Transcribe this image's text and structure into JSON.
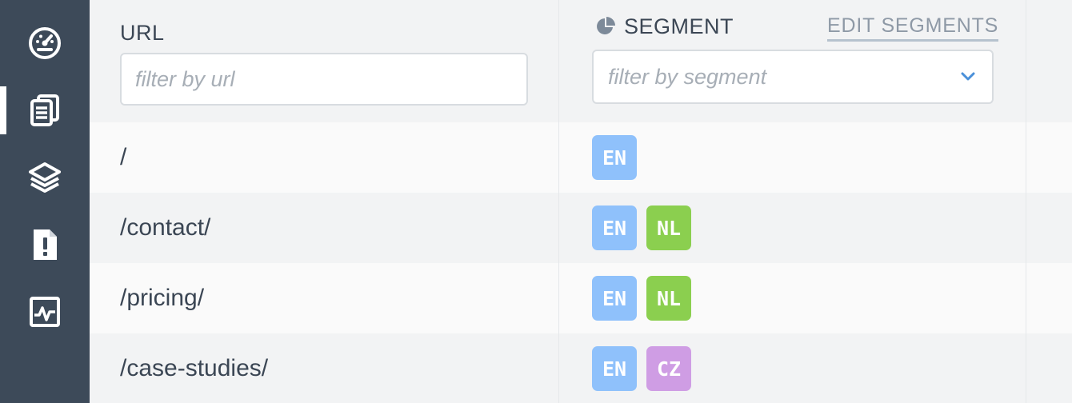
{
  "sidebar": {
    "items": [
      {
        "icon": "dashboard-icon",
        "active": false
      },
      {
        "icon": "pages-icon",
        "active": true
      },
      {
        "icon": "layers-icon",
        "active": false
      },
      {
        "icon": "alert-document-icon",
        "active": false
      },
      {
        "icon": "activity-icon",
        "active": false
      }
    ]
  },
  "header": {
    "url_label": "URL",
    "url_placeholder": "filter by url",
    "segment_label": "SEGMENT",
    "edit_segments": "EDIT SEGMENTS",
    "segment_placeholder": "filter by segment"
  },
  "colors": {
    "EN": "#8fc1fb",
    "NL": "#8bcf4f",
    "CZ": "#cf9de4",
    "sidebar": "#3d4a59"
  },
  "rows": [
    {
      "url": "/",
      "segments": [
        "EN"
      ]
    },
    {
      "url": "/contact/",
      "segments": [
        "EN",
        "NL"
      ]
    },
    {
      "url": "/pricing/",
      "segments": [
        "EN",
        "NL"
      ]
    },
    {
      "url": "/case-studies/",
      "segments": [
        "EN",
        "CZ"
      ]
    }
  ]
}
